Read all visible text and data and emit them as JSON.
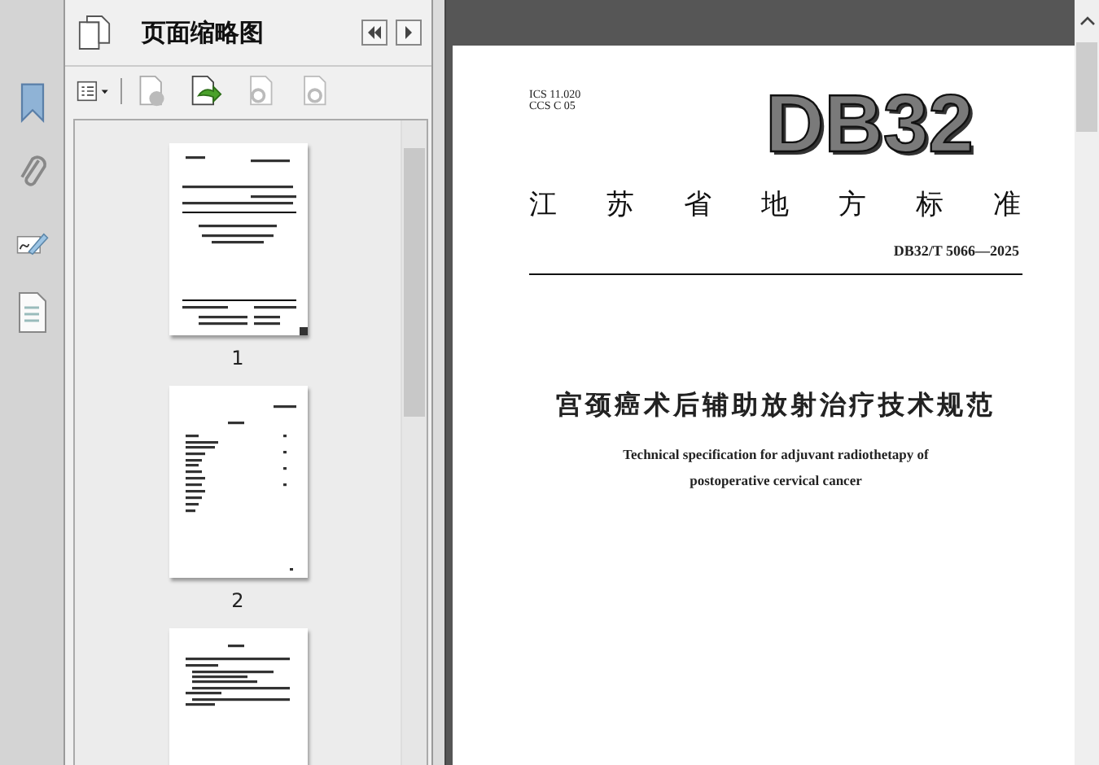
{
  "sidebar": {
    "title": "页面缩略图",
    "thumbnails": [
      {
        "kind": "cover",
        "label": "1"
      },
      {
        "kind": "contents",
        "label": "2"
      },
      {
        "kind": "text"
      }
    ]
  },
  "document": {
    "ics": "ICS 11.020",
    "ccs": "CCS C 05",
    "code": "DB32",
    "issuer": "江苏省地方标准",
    "number": "DB32/T 5066—2025",
    "title": "宫颈癌术后辅助放射治疗技术规范",
    "english_title": [
      "Technical specification for adjuvant radiothetapy of",
      "postoperative cervical cancer"
    ]
  }
}
